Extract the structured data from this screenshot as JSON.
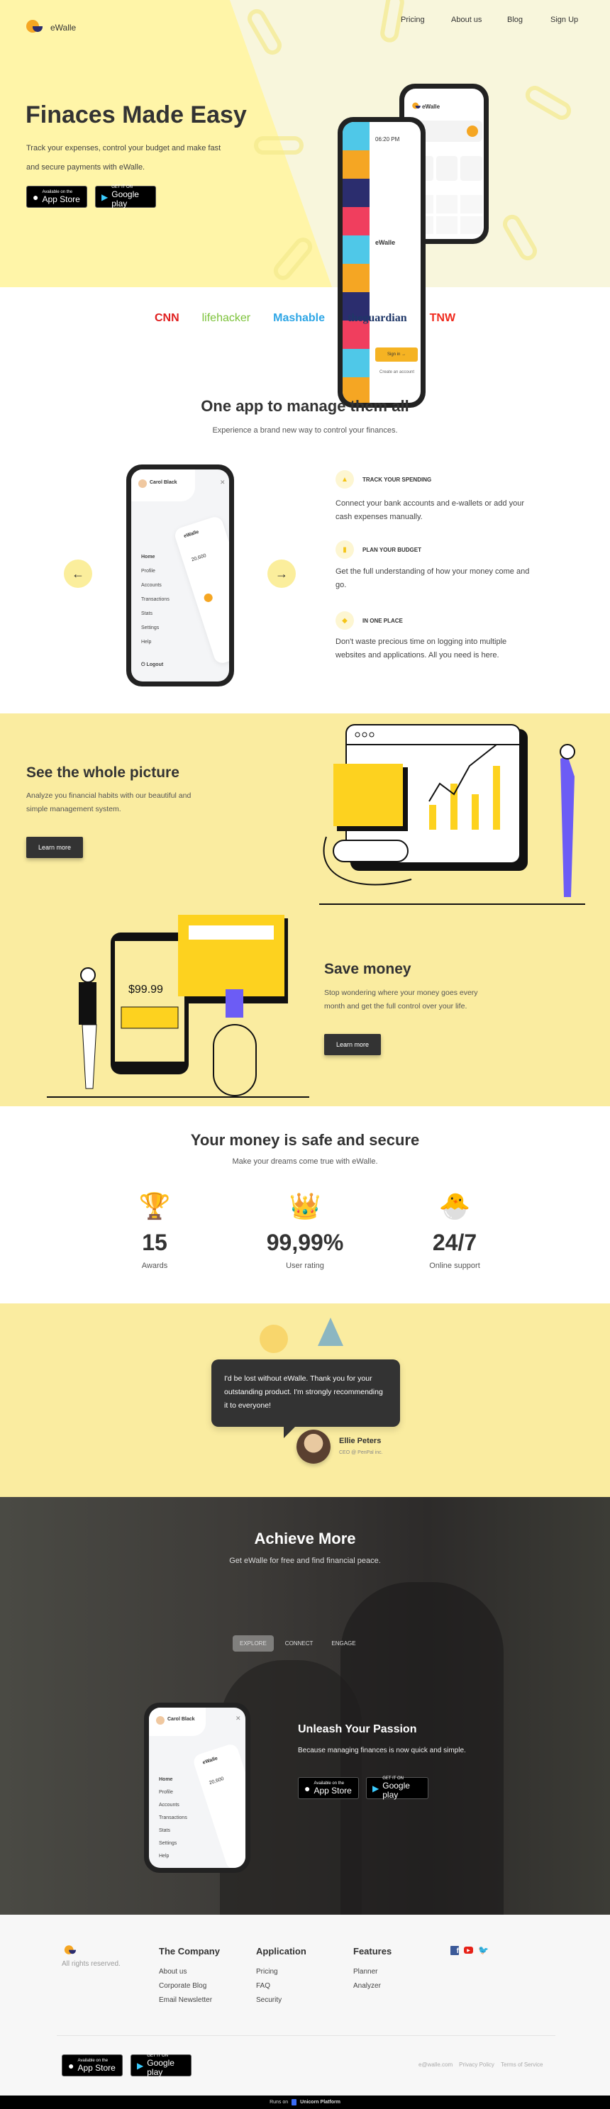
{
  "brand": {
    "name": "eWalle",
    "colors": {
      "yellow": "#faeca0",
      "orange": "#f5a623",
      "navy": "#2b2d6e",
      "dark": "#333333"
    }
  },
  "nav": {
    "items": [
      "Pricing",
      "About us",
      "Blog",
      "Sign Up"
    ]
  },
  "hero": {
    "title": "Finaces Made Easy",
    "text": "Track your expenses, control your budget and make fast and secure payments with eWalle.",
    "app_store": {
      "small": "Available on the",
      "large": "App Store"
    },
    "google_play": {
      "small": "GET IT ON",
      "large": "Google play"
    },
    "phone1": {
      "time": "06:20 PM",
      "brand": "eWalle",
      "sign_in": "Sign in →",
      "create": "Create an account"
    },
    "phone2": {
      "brand": "eWalle"
    }
  },
  "press": [
    "CNN",
    "lifehacker",
    "Mashable",
    "theguardian",
    "TNW"
  ],
  "manage": {
    "title": "One app to manage them all",
    "subtitle": "Experience a brand new way to control your finances.",
    "phone": {
      "user": "Carol Black",
      "menu": [
        "Home",
        "Profile",
        "Accounts",
        "Transactions",
        "Stats",
        "Settings",
        "Help"
      ],
      "logout": "Logout",
      "brand": "eWalle",
      "balance": "20,600"
    },
    "features": [
      {
        "icon": "bell-icon",
        "title": "TRACK YOUR SPENDING",
        "text": "Connect your bank accounts and e-wallets or add your cash expenses manually."
      },
      {
        "icon": "chart-icon",
        "title": "PLAN YOUR BUDGET",
        "text": "Get the full understanding of how your money come and go."
      },
      {
        "icon": "link-icon",
        "title": "IN ONE PLACE",
        "text": "Don't waste precious time on logging into multiple websites and applications. All you need is here."
      }
    ]
  },
  "picture": {
    "title": "See the whole picture",
    "text": "Analyze you financial habits with our beautiful and simple management system.",
    "button": "Learn more"
  },
  "save": {
    "title": "Save money",
    "text": "Stop wondering where your money goes every month and get the full control over your life.",
    "button": "Learn more",
    "price": "$99.99"
  },
  "secure": {
    "title": "Your money is safe and secure",
    "subtitle": "Make your dreams come true with eWalle.",
    "stats": [
      {
        "icon": "trophy-icon",
        "value": "15",
        "label": "Awards"
      },
      {
        "icon": "crown-icon",
        "value": "99,99%",
        "label": "User rating"
      },
      {
        "icon": "chick-icon",
        "value": "24/7",
        "label": "Online support"
      }
    ]
  },
  "testimonial": {
    "quote": "I'd be lost without eWalle. Thank you for your outstanding product. I'm strongly recommending it to everyone!",
    "name": "Ellie Peters",
    "role": "CEO @ PenPal inc."
  },
  "achieve": {
    "title": "Achieve More",
    "subtitle": "Get eWalle for free and find financial peace.",
    "tabs": [
      "EXPLORE",
      "CONNECT",
      "ENGAGE"
    ],
    "active_tab": "EXPLORE",
    "heading": "Unleash Your Passion",
    "text": "Because managing finances is now quick and simple."
  },
  "footer": {
    "rights": "All rights reserved.",
    "columns": [
      {
        "title": "The Company",
        "links": [
          "About us",
          "Corporate Blog",
          "Email Newsletter"
        ]
      },
      {
        "title": "Application",
        "links": [
          "Pricing",
          "FAQ",
          "Security"
        ]
      },
      {
        "title": "Features",
        "links": [
          "Planner",
          "Analyzer"
        ]
      }
    ],
    "social": [
      "facebook-icon",
      "youtube-icon",
      "twitter-icon"
    ],
    "bottom_links": [
      "e@walle.com",
      "Privacy Policy",
      "Terms of Service"
    ],
    "runs_on": "Runs on",
    "platform": "Unicorn Platform"
  }
}
